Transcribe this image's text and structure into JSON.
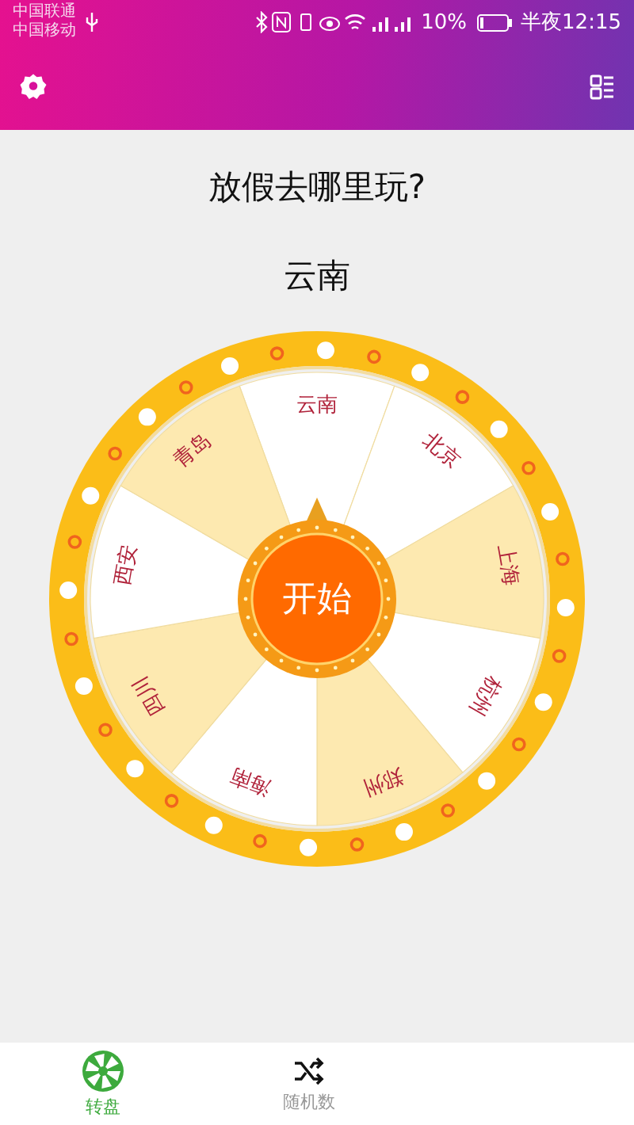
{
  "status_bar": {
    "carriers": [
      "中国联通",
      "中国移动"
    ],
    "battery": "10%",
    "time": "半夜12:15"
  },
  "question": "放假去哪里玩?",
  "result": "云南",
  "wheel": {
    "start_label": "开始",
    "segments": [
      {
        "label": "云南",
        "color": "#ffffff"
      },
      {
        "label": "北京",
        "color": "#ffffff"
      },
      {
        "label": "上海",
        "color": "#fde9b0"
      },
      {
        "label": "杭州",
        "color": "#ffffff"
      },
      {
        "label": "郑州",
        "color": "#fde9b0"
      },
      {
        "label": "海南",
        "color": "#ffffff"
      },
      {
        "label": "四川",
        "color": "#fde9b0"
      },
      {
        "label": "西安",
        "color": "#ffffff"
      },
      {
        "label": "青岛",
        "color": "#fde9b0"
      }
    ]
  },
  "nav": [
    {
      "label": "转盘",
      "selected": true,
      "kind": "wheel"
    },
    {
      "label": "随机数",
      "selected": false,
      "kind": "shuffle"
    }
  ]
}
